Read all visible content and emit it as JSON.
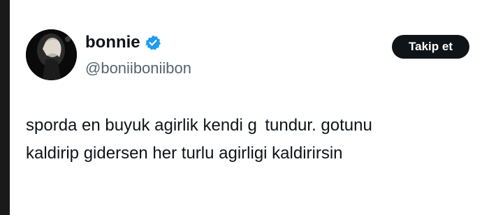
{
  "user": {
    "display_name": "bonnie",
    "handle": "@boniiboniibon",
    "verified_icon": "verified-badge-icon",
    "verified_color": "#1d9bf0"
  },
  "follow_button": {
    "label": "Takip et"
  },
  "tweet": {
    "lines": [
      "sporda en buyuk agirlik kendi g  tundur. gotunu",
      "kaldirip gidersen her turlu agirligi kaldirirsin"
    ]
  }
}
